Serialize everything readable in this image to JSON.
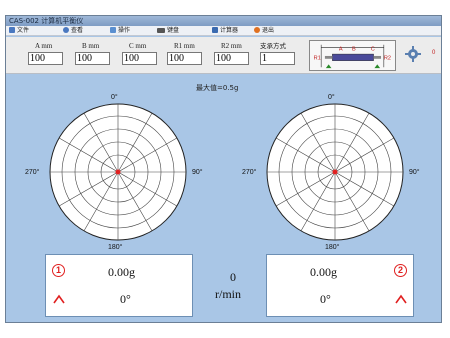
{
  "window": {
    "title": "CAS-002 计算机平衡仪"
  },
  "menu": [
    {
      "label": "文件",
      "icon": "file-icon",
      "color": "#4a78c0"
    },
    {
      "label": "查看",
      "icon": "view-icon",
      "color": "#4a78c0"
    },
    {
      "label": "操作",
      "icon": "operate-icon",
      "color": "#5a8fd0"
    },
    {
      "label": "键盘",
      "icon": "keyboard-icon",
      "color": "#555555"
    },
    {
      "label": "计算器",
      "icon": "calculator-icon",
      "color": "#3a6ab0"
    },
    {
      "label": "退出",
      "icon": "exit-icon",
      "color": "#e07020"
    }
  ],
  "fields": [
    {
      "label": "A  mm",
      "value": "100"
    },
    {
      "label": "B  mm",
      "value": "100"
    },
    {
      "label": "C  mm",
      "value": "100"
    },
    {
      "label": "R1  mm",
      "value": "100"
    },
    {
      "label": "R2  mm",
      "value": "100"
    },
    {
      "label": "支承方式",
      "value": "1"
    }
  ],
  "diagram": {
    "a": "A",
    "b": "B",
    "c": "C",
    "r1": "R1",
    "r2": "R2"
  },
  "status_zero": "0",
  "max_label": "最大值=0.5g",
  "polar_labels": {
    "top": "0°",
    "right": "90°",
    "bottom": "180°",
    "left": "270°"
  },
  "plane1": {
    "number": "1",
    "amplitude": "0.00g",
    "angle": "0°"
  },
  "plane2": {
    "number": "2",
    "amplitude": "0.00g",
    "angle": "0°"
  },
  "speed": {
    "value": "0",
    "unit": "r/min"
  },
  "colors": {
    "background": "#a9c6e6",
    "accent_red": "#e02020",
    "panel_border": "#6d8fb4"
  }
}
